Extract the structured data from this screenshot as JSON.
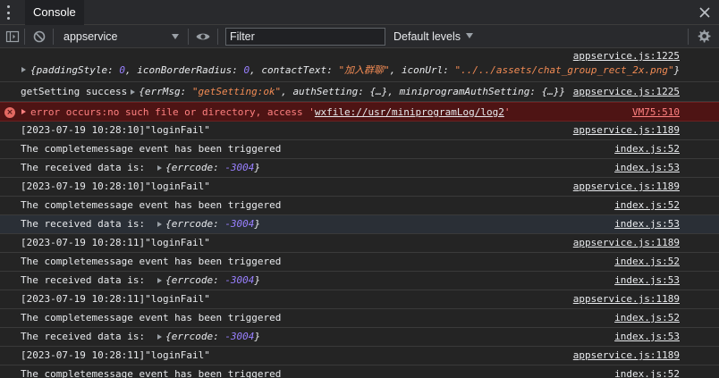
{
  "tabbar": {
    "tab_label": "Console"
  },
  "toolbar": {
    "context": "appservice",
    "filter_placeholder": "Filter",
    "levels_label": "Default levels"
  },
  "log": {
    "entry0": {
      "source": "appservice.js:1225",
      "open_brace": "{",
      "k1": "paddingStyle",
      "v1": "0",
      "k2": "iconBorderRadius",
      "v2": "0",
      "k3": "contactText",
      "v3": "\"加入群聊\"",
      "k4": "iconUrl",
      "v4": "\"../../assets/chat_group_rect_2x.png\"",
      "close_brace": "}"
    },
    "entry1": {
      "prefix": "getSetting success",
      "k1": "errMsg",
      "v1": "\"getSetting:ok\"",
      "k2": "authSetting",
      "v2": "{…}",
      "k3": "miniprogramAuthSetting",
      "v3": "{…}",
      "source": "appservice.js:1225"
    },
    "error": {
      "prefix": "error occurs:no such file or directory, access '",
      "path": "wxfile://usr/miniprogramLog/log2",
      "suffix": "'",
      "source": "VM75:510"
    },
    "rows": [
      {
        "text": "[2023-07-19 10:28:10]\"loginFail\"",
        "source": "appservice.js:1189"
      },
      {
        "text": "The completemessage event has been triggered",
        "source": "index.js:52"
      },
      {
        "text": "The received data is:",
        "obj_key": "errcode",
        "obj_val": "-3004",
        "source": "index.js:53"
      },
      {
        "text": "[2023-07-19 10:28:10]\"loginFail\"",
        "source": "appservice.js:1189"
      },
      {
        "text": "The completemessage event has been triggered",
        "source": "index.js:52"
      },
      {
        "text": "The received data is:",
        "obj_key": "errcode",
        "obj_val": "-3004",
        "source": "index.js:53"
      },
      {
        "text": "[2023-07-19 10:28:11]\"loginFail\"",
        "source": "appservice.js:1189"
      },
      {
        "text": "The completemessage event has been triggered",
        "source": "index.js:52"
      },
      {
        "text": "The received data is:",
        "obj_key": "errcode",
        "obj_val": "-3004",
        "source": "index.js:53"
      },
      {
        "text": "[2023-07-19 10:28:11]\"loginFail\"",
        "source": "appservice.js:1189"
      },
      {
        "text": "The completemessage event has been triggered",
        "source": "index.js:52"
      },
      {
        "text": "The received data is:",
        "obj_key": "errcode",
        "obj_val": "-3004",
        "source": "index.js:53"
      },
      {
        "text": "[2023-07-19 10:28:11]\"loginFail\"",
        "source": "appservice.js:1189"
      },
      {
        "text": "The completemessage event has been triggered",
        "source": "index.js:52"
      }
    ]
  },
  "colors": {
    "background": "#242424",
    "toolbar": "#292a2d",
    "error_bg": "#4e1414",
    "error_text": "#ff8080",
    "string": "#f28b54",
    "number": "#9980ff"
  }
}
